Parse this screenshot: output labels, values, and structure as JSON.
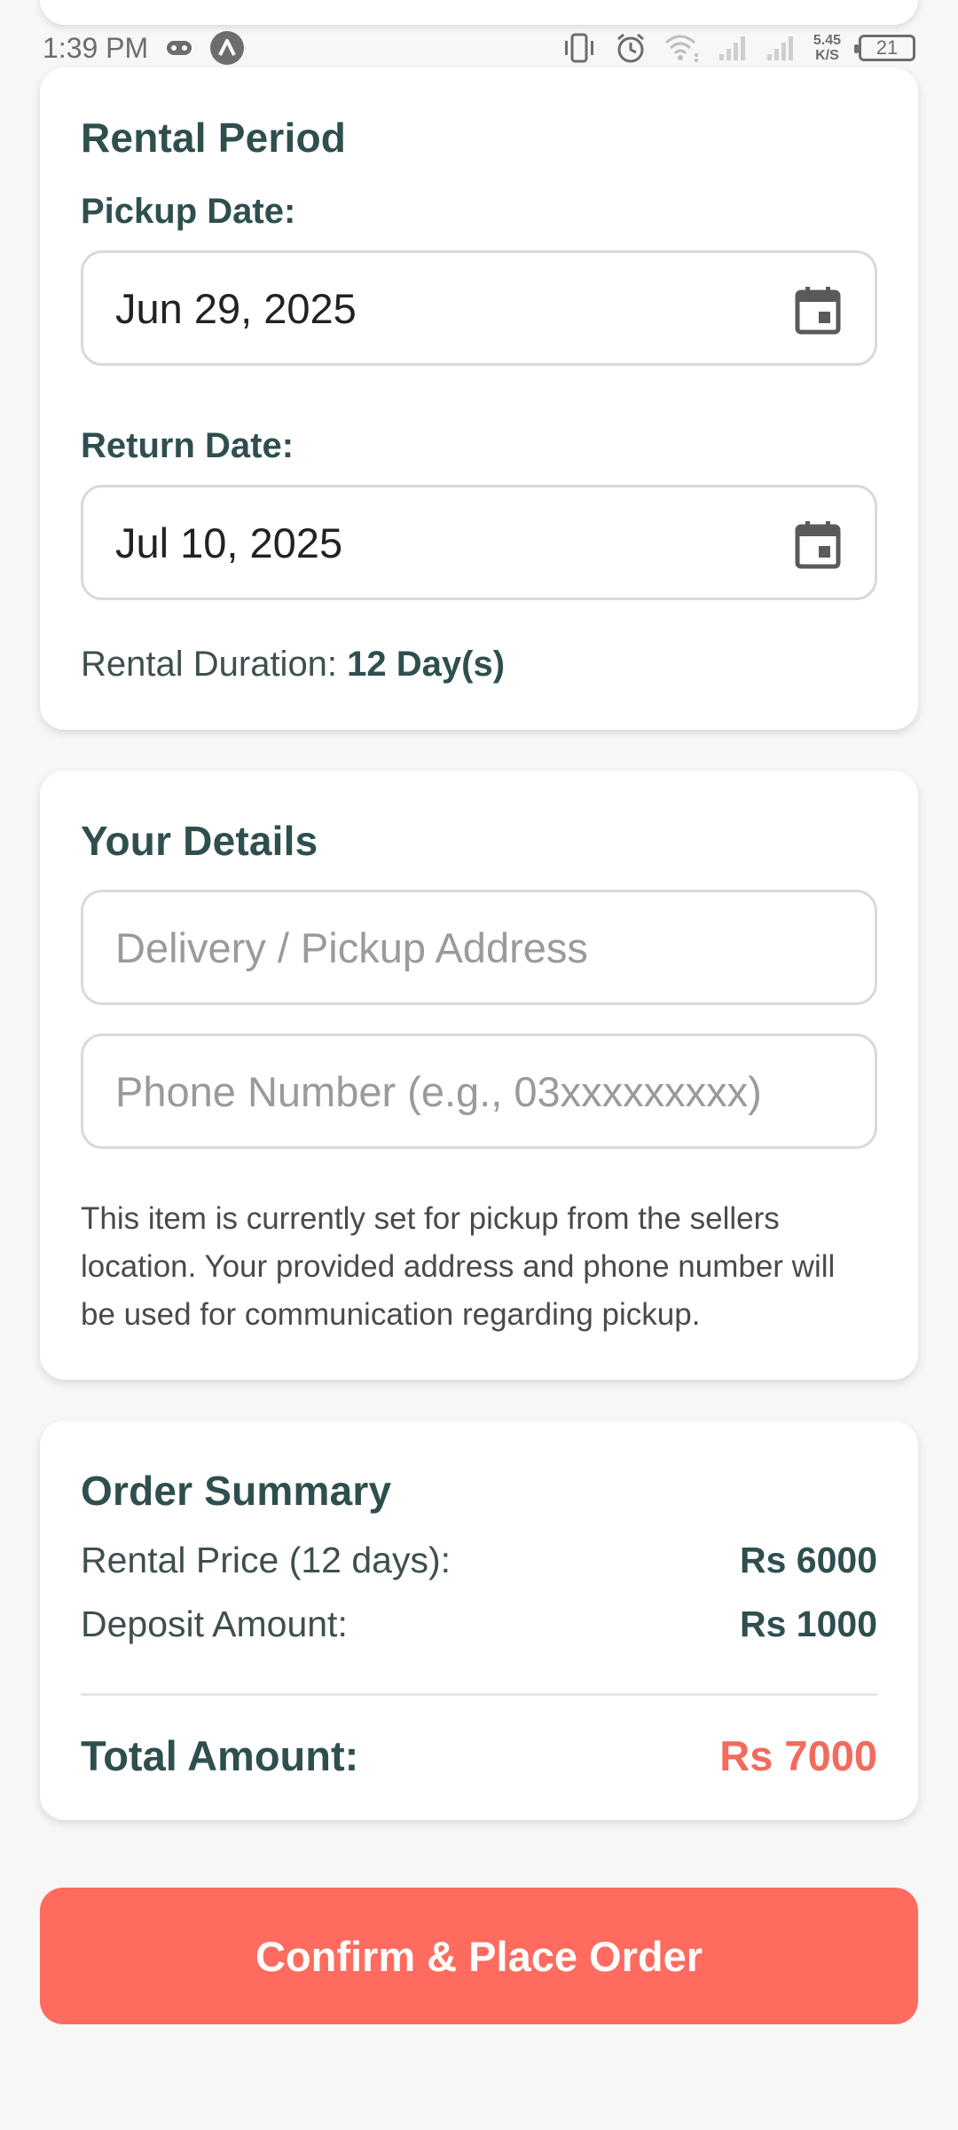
{
  "status_bar": {
    "time": "1:39 PM",
    "speed_value": "5.45",
    "speed_unit": "K/S",
    "battery": "21"
  },
  "rental_period": {
    "title": "Rental Period",
    "pickup_label": "Pickup Date:",
    "pickup_value": "Jun 29, 2025",
    "return_label": "Return Date:",
    "return_value": "Jul 10, 2025",
    "duration_label": "Rental Duration:",
    "duration_value": "12 Day(s)"
  },
  "your_details": {
    "title": "Your Details",
    "address_placeholder": "Delivery / Pickup Address",
    "phone_placeholder": "Phone Number (e.g., 03xxxxxxxxx)",
    "note": "This item is currently set for pickup from the sellers location. Your provided address and phone number will be used for communication regarding pickup."
  },
  "order_summary": {
    "title": "Order Summary",
    "rental_price_label": "Rental Price (12 days):",
    "rental_price_value": "Rs 6000",
    "deposit_label": "Deposit Amount:",
    "deposit_value": "Rs 1000",
    "total_label": "Total Amount:",
    "total_value": "Rs 7000"
  },
  "actions": {
    "confirm_label": "Confirm & Place Order"
  },
  "colors": {
    "heading": "#2f4f4f",
    "accent": "#ff6b5e",
    "total": "#f26b5e"
  }
}
